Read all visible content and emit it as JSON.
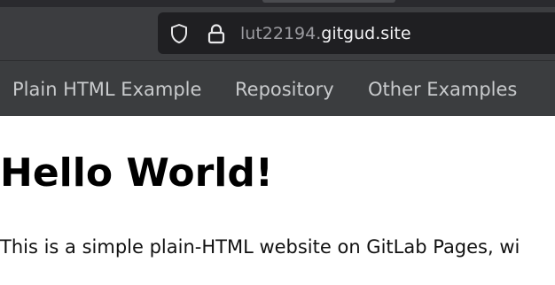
{
  "browser": {
    "url_subdomain": "lut22194.",
    "url_domain": "gitgud.site",
    "icons": [
      "shield-icon",
      "lock-icon"
    ]
  },
  "nav": {
    "links": [
      {
        "label": "Plain HTML Example"
      },
      {
        "label": "Repository"
      },
      {
        "label": "Other Examples"
      }
    ]
  },
  "content": {
    "title": "Hello World!",
    "intro": "This is a simple plain-HTML website on GitLab Pages, wi"
  },
  "colors": {
    "toolbar": "#3c3d40",
    "urlbar": "#1f1f22",
    "navbar": "#3b3d3f",
    "nav_link": "#c8cacc"
  }
}
